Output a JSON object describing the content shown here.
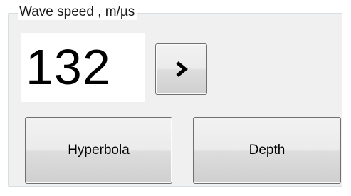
{
  "wave_speed": {
    "title": "Wave speed , m/µs",
    "value": "132"
  },
  "buttons": {
    "next_icon": "chevron-right-icon",
    "hyperbola_label": "Hyperbola",
    "depth_label": "Depth"
  },
  "colors": {
    "button_border": "#707070",
    "frame_border": "#d5dfe5",
    "panel_background": "#f0f0f0"
  }
}
